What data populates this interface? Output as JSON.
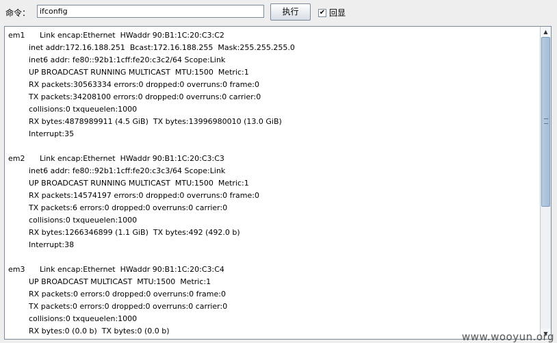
{
  "toolbar": {
    "command_label": "命令：",
    "command_value": "ifconfig",
    "execute_label": "执行",
    "echo_label": "回显",
    "echo_checked": true
  },
  "output": {
    "interfaces": [
      {
        "name": "em1",
        "first": "Link encap:Ethernet  HWaddr 90:B1:1C:20:C3:C2",
        "lines": [
          "inet addr:172.16.188.251  Bcast:172.16.188.255  Mask:255.255.255.0",
          "inet6 addr: fe80::92b1:1cff:fe20:c3c2/64 Scope:Link",
          "UP BROADCAST RUNNING MULTICAST  MTU:1500  Metric:1",
          "RX packets:30563334 errors:0 dropped:0 overruns:0 frame:0",
          "TX packets:34208100 errors:0 dropped:0 overruns:0 carrier:0",
          "collisions:0 txqueuelen:1000",
          "RX bytes:4878989911 (4.5 GiB)  TX bytes:13996980010 (13.0 GiB)",
          "Interrupt:35"
        ]
      },
      {
        "name": "em2",
        "first": "Link encap:Ethernet  HWaddr 90:B1:1C:20:C3:C3",
        "lines": [
          "inet6 addr: fe80::92b1:1cff:fe20:c3c3/64 Scope:Link",
          "UP BROADCAST RUNNING MULTICAST  MTU:1500  Metric:1",
          "RX packets:14574197 errors:0 dropped:0 overruns:0 frame:0",
          "TX packets:6 errors:0 dropped:0 overruns:0 carrier:0",
          "collisions:0 txqueuelen:1000",
          "RX bytes:1266346899 (1.1 GiB)  TX bytes:492 (492.0 b)",
          "Interrupt:38"
        ]
      },
      {
        "name": "em3",
        "first": "Link encap:Ethernet  HWaddr 90:B1:1C:20:C3:C4",
        "lines": [
          "UP BROADCAST MULTICAST  MTU:1500  Metric:1",
          "RX packets:0 errors:0 dropped:0 overruns:0 frame:0",
          "TX packets:0 errors:0 dropped:0 overruns:0 carrier:0",
          "collisions:0 txqueuelen:1000",
          "RX bytes:0 (0.0 b)  TX bytes:0 (0.0 b)"
        ]
      }
    ]
  },
  "scrollbar": {
    "up_icon": "▲",
    "down_icon": "▼"
  },
  "watermark": "www.wooyun.org"
}
